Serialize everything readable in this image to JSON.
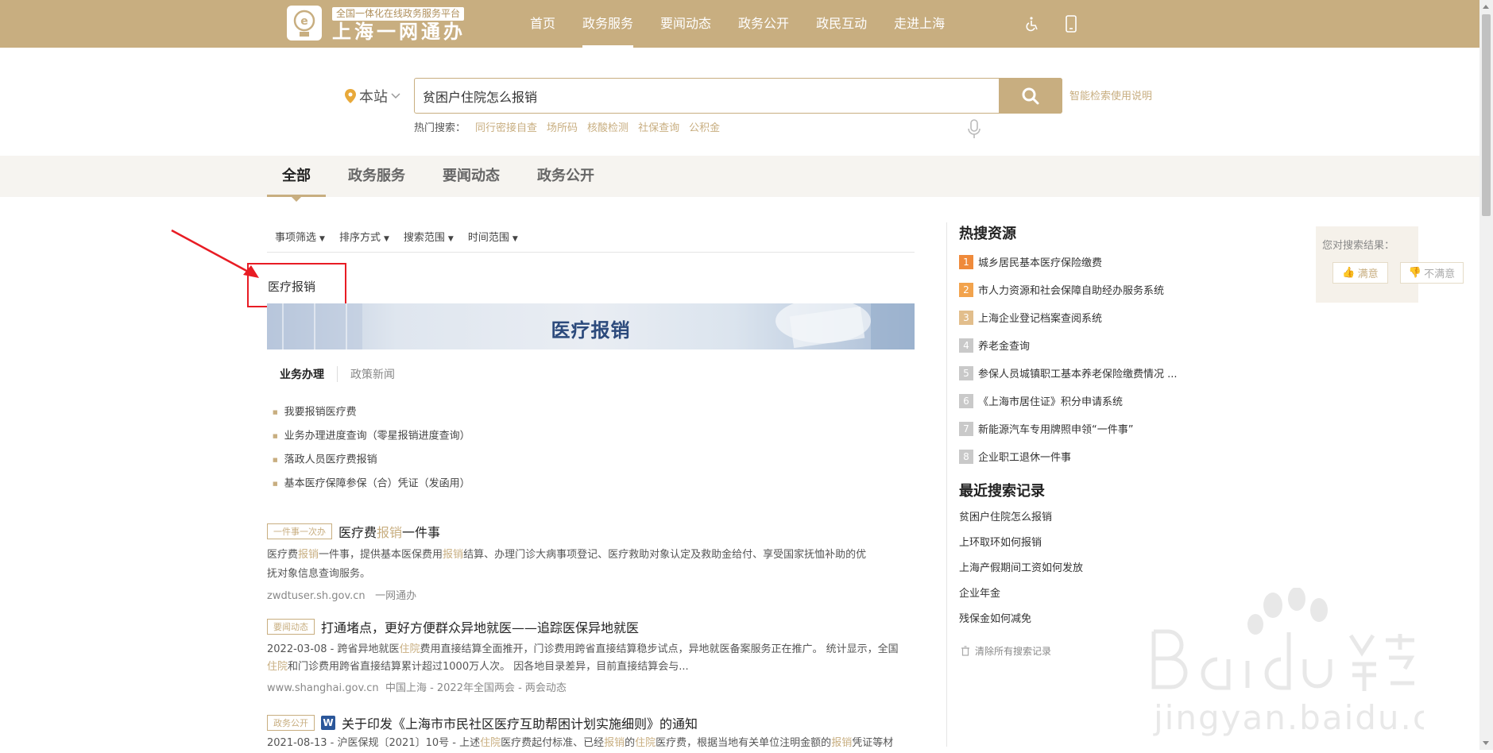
{
  "topbar": {
    "logo_icon": "shanghai-emblem-icon",
    "logo_subtitle": "全国一体化在线政务服务平台",
    "logo_title": "上海一网通办",
    "nav": [
      {
        "label": "首页"
      },
      {
        "label": "政务服务",
        "active": true
      },
      {
        "label": "要闻动态"
      },
      {
        "label": "政务公开"
      },
      {
        "label": "政民互动"
      },
      {
        "label": "走进上海"
      }
    ],
    "accessibility_icon": "wheelchair-icon",
    "mobile_icon": "mobile-phone-icon"
  },
  "search": {
    "location": "本站",
    "query": "贫困户住院怎么报销",
    "help_link": "智能检索使用说明",
    "hot_label": "热门搜索：",
    "hot_keywords": [
      "同行密接自查",
      "场所码",
      "核酸检测",
      "社保查询",
      "公积金"
    ]
  },
  "tabs": [
    {
      "label": "全部",
      "active": true
    },
    {
      "label": "政务服务"
    },
    {
      "label": "要闻动态"
    },
    {
      "label": "政务公开"
    }
  ],
  "filters": [
    "事项筛选",
    "排序方式",
    "搜索范围",
    "时间范围"
  ],
  "card": {
    "title": "医疗报销",
    "banner_title": "医疗报销",
    "subtabs": [
      {
        "label": "业务办理",
        "active": true
      },
      {
        "label": "政策新闻"
      }
    ],
    "services": [
      "我要报销医疗费",
      "业务办理进度查询（零星报销进度查询）",
      "落政人员医疗费报销",
      "基本医疗保障参保（合）凭证（发函用）"
    ]
  },
  "results": [
    {
      "tag": "一件事一次办",
      "title_pre": "医疗费",
      "title_hl": "报销",
      "title_post": "一件事",
      "desc_line1_a": "医疗费",
      "desc_line1_hl": "报销",
      "desc_line1_b": "一件事，提供基本医保费用",
      "desc_line1_hl2": "报销",
      "desc_line1_c": "结算、办理门诊大病事项登记、医疗救助对象认定及救助金给付、享受国家抚恤补助的优",
      "desc_line2": "抚对象信息查询服务。",
      "source": "zwdtuser.sh.gov.cn",
      "source_name": "一网通办"
    },
    {
      "tag": "要闻动态",
      "title": "打通堵点，更好方便群众异地就医——追踪医保异地就医",
      "desc_line1_a": "2022-03-08 -  跨省异地就医",
      "desc_line1_hl": "住院",
      "desc_line1_b": "费用直接结算全面推开，门诊费用跨省直接结算稳步试点，异地就医备案服务正在推广。 统计显示，全国",
      "desc_line2_hl": "住院",
      "desc_line2_b": "和门诊费用跨省直接结算累计超过1000万人次。         因各地目录差异，目前直接结算会与...",
      "source": "www.shanghai.gov.cn",
      "source_name": "中国上海 - 2022年全国两会 - 两会动态"
    },
    {
      "tag": "政务公开",
      "doc_icon": "word-document-icon",
      "doc_icon_letter": "W",
      "title": "关于印发《上海市市民社区医疗互助帮困计划实施细则》的通知",
      "desc_a": "2021-08-13 -  沪医保规〔2021〕10号 -  上述",
      "desc_hl1": "住院",
      "desc_b": "医疗费起付标准、已经",
      "desc_hl2": "报销",
      "desc_c": "的",
      "desc_hl3": "住院",
      "desc_d": "医疗费，根据当地有关单位注明金额的",
      "desc_hl4": "报销",
      "desc_e": "凭证等材"
    }
  ],
  "sidebar": {
    "hot_heading": "热搜资源",
    "hot_items": [
      {
        "rank": "1",
        "label": "城乡居民基本医疗保险缴费"
      },
      {
        "rank": "2",
        "label": "市人力资源和社会保障自助经办服务系统"
      },
      {
        "rank": "3",
        "label": "上海企业登记档案查阅系统"
      },
      {
        "rank": "4",
        "label": "养老金查询"
      },
      {
        "rank": "5",
        "label": "参保人员城镇职工基本养老保险缴费情况 ..."
      },
      {
        "rank": "6",
        "label": "《上海市居住证》积分申请系统"
      },
      {
        "rank": "7",
        "label": "新能源汽车专用牌照申领“一件事”"
      },
      {
        "rank": "8",
        "label": "企业职工退休一件事"
      }
    ],
    "recent_heading": "最近搜索记录",
    "recent_items": [
      "贫困户住院怎么报销",
      "上环取环如何报销",
      "上海产假期间工资如何发放",
      "企业年金",
      "残保金如何减免"
    ],
    "clear_label": "清除所有搜索记录"
  },
  "feedback": {
    "question": "您对搜索结果：",
    "satisfied": "满意",
    "unsatisfied": "不满意"
  },
  "colors": {
    "brand": "#c8ae80",
    "annotation_red": "#e81c24"
  }
}
